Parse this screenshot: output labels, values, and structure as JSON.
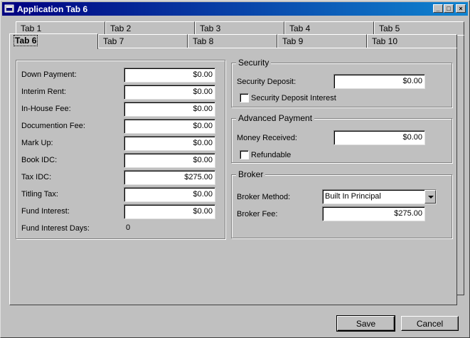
{
  "window": {
    "title": "Application Tab 6",
    "minimize_glyph": "_",
    "maximize_glyph": "□",
    "close_glyph": "×"
  },
  "tabs_row1": [
    "Tab 1",
    "Tab 2",
    "Tab 3",
    "Tab 4",
    "Tab 5"
  ],
  "tabs_row2": [
    "Tab 6",
    "Tab 7",
    "Tab 8",
    "Tab 9",
    "Tab 10"
  ],
  "active_tab": "Tab 6",
  "left_form": {
    "fields": [
      {
        "label": "Down Payment:",
        "value": "$0.00"
      },
      {
        "label": "Interim Rent:",
        "value": "$0.00"
      },
      {
        "label": "In-House Fee:",
        "value": "$0.00"
      },
      {
        "label": "Documention Fee:",
        "value": "$0.00"
      },
      {
        "label": "Mark Up:",
        "value": "$0.00"
      },
      {
        "label": "Book IDC:",
        "value": "$0.00"
      },
      {
        "label": "Tax IDC:",
        "value": "$275.00"
      },
      {
        "label": "Titling Tax:",
        "value": "$0.00"
      },
      {
        "label": "Fund Interest:",
        "value": "$0.00"
      }
    ],
    "fund_interest_days_label": "Fund Interest Days:",
    "fund_interest_days_value": "0"
  },
  "security": {
    "title": "Security",
    "deposit_label": "Security Deposit:",
    "deposit_value": "$0.00",
    "interest_checkbox_label": "Security Deposit Interest",
    "interest_checked": false
  },
  "advanced_payment": {
    "title": "Advanced Payment",
    "money_received_label": "Money Received:",
    "money_received_value": "$0.00",
    "refundable_label": "Refundable",
    "refundable_checked": false
  },
  "broker": {
    "title": "Broker",
    "method_label": "Broker Method:",
    "method_value": "Built In Principal",
    "fee_label": "Broker Fee:",
    "fee_value": "$275.00"
  },
  "buttons": {
    "save": "Save",
    "cancel": "Cancel"
  },
  "colors": {
    "title_gradient_start": "#000080",
    "title_gradient_end": "#1084d0",
    "face": "#c0c0c0"
  }
}
